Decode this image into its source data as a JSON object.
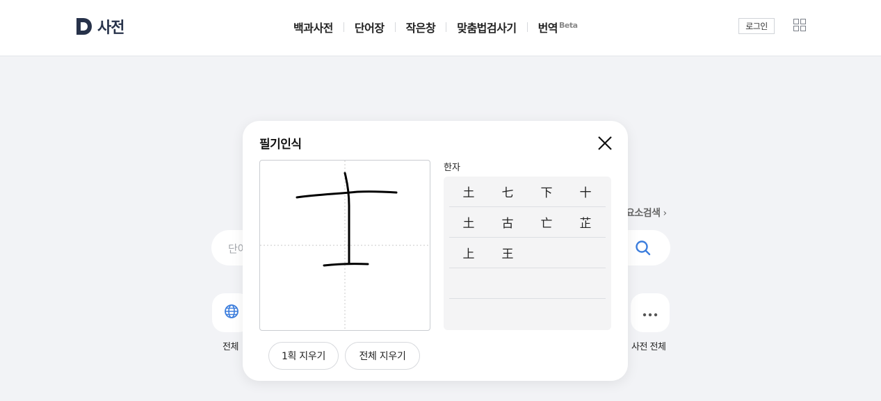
{
  "header": {
    "logo_text": "사전",
    "nav": [
      {
        "label": "백과사전"
      },
      {
        "label": "단어장"
      },
      {
        "label": "작은창"
      },
      {
        "label": "맞춤법검사기"
      },
      {
        "label": "번역",
        "badge": "Beta"
      }
    ],
    "login_label": "로그인"
  },
  "search": {
    "placeholder": "단어"
  },
  "element_search": {
    "label": "요소검색",
    "chevron": "›"
  },
  "categories": {
    "left_label": "전체",
    "right_label": "사전 전체"
  },
  "modal": {
    "title": "필기인식",
    "result_title": "한자",
    "results": [
      [
        "土",
        "七",
        "下",
        "十"
      ],
      [
        "土",
        "古",
        "亡",
        "芷"
      ],
      [
        "上",
        "王"
      ],
      [],
      []
    ],
    "undo_stroke_label": "1획 지우기",
    "clear_all_label": "전체 지우기"
  },
  "colors": {
    "brand": "#27324a",
    "accent_blue": "#3b7ddd",
    "page_bg": "#f2f3f6"
  }
}
